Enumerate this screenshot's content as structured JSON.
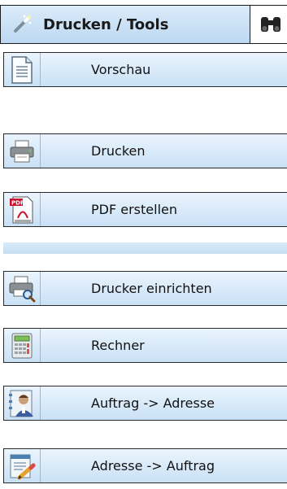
{
  "tabs": {
    "active_label": "Drucken / Tools",
    "active_icon": "magic-wand-icon",
    "next_icon": "binoculars-icon"
  },
  "buttons": [
    {
      "label": "Vorschau",
      "icon": "document-preview-icon"
    },
    {
      "label": "Drucken",
      "icon": "printer-icon"
    },
    {
      "label": "PDF erstellen",
      "icon": "pdf-icon"
    },
    {
      "label": "Drucker einrichten",
      "icon": "printer-setup-icon"
    },
    {
      "label": "Rechner",
      "icon": "calculator-icon"
    },
    {
      "label": "Auftrag -> Adresse",
      "icon": "order-to-address-icon"
    },
    {
      "label": "Adresse -> Auftrag",
      "icon": "address-to-order-icon"
    }
  ],
  "colors": {
    "accent": "#c9e1f6",
    "border": "#2a2a2a"
  }
}
